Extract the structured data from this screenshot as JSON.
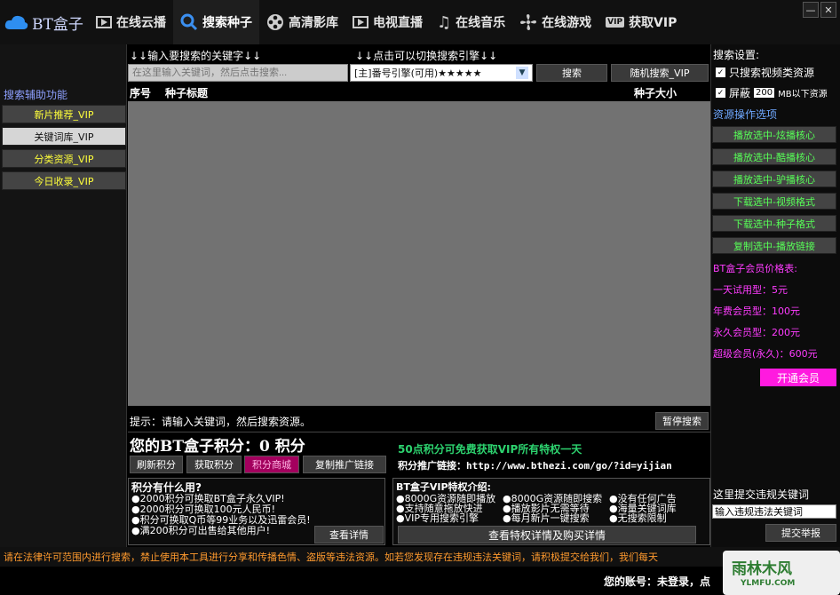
{
  "app": {
    "logo_text": "BT盒子"
  },
  "nav": [
    {
      "label": "在线云播",
      "icon": "play-icon"
    },
    {
      "label": "搜索种子",
      "icon": "search-icon",
      "active": true
    },
    {
      "label": "高清影库",
      "icon": "film-reel-icon"
    },
    {
      "label": "电视直播",
      "icon": "tv-icon"
    },
    {
      "label": "在线音乐",
      "icon": "music-icon"
    },
    {
      "label": "在线游戏",
      "icon": "fan-icon"
    },
    {
      "label": "获取VIP",
      "icon": "vip-icon"
    }
  ],
  "left": {
    "title": "搜索辅助功能",
    "items": [
      "新片推荐_VIP",
      "关键词库_VIP",
      "分类资源_VIP",
      "今日收录_VIP"
    ]
  },
  "search": {
    "hint_left": "↓↓输入要搜索的关键字↓↓",
    "hint_right": "↓↓点击可以切换搜索引擎↓↓",
    "placeholder": "在这里输入关键词，然后点击搜索...",
    "engine": "[主]番号引擎(可用)★★★★★",
    "search_btn": "搜索",
    "random_btn": "随机搜索_VIP"
  },
  "table": {
    "col_index": "序号",
    "col_title": "种子标题",
    "col_size": "种子大小"
  },
  "status": {
    "hint": "提示：请输入关键词，然后搜索资源。",
    "pause": "暂停搜索"
  },
  "points": {
    "label": "您的BT盒子积分：0 积分",
    "promo": "50点积分可免费获取VIP所有特权一天",
    "buttons": [
      "刷新积分",
      "获取积分",
      "积分商城",
      "复制推广链接"
    ],
    "link_label": "积分推广链接：http://www.bthezi.com/go/?id=yijian"
  },
  "points_box": {
    "title": "积分有什么用?",
    "lines": [
      "●2000积分可换取BT盒子永久VIP!",
      "●2000积分可换取100元人民币!",
      "●积分可换取Q币等99业务以及迅雷会员!",
      "●满200积分可出售给其他用户!"
    ],
    "btn": "查看详情"
  },
  "vip_box": {
    "title": "BT盒子VIP特权介绍:",
    "cells": [
      "●8000G资源随即播放",
      "●8000G资源随即搜索",
      "●没有任何广告",
      "●支持随意拖放快进",
      "●播放影片无需等待",
      "●海量关键词库",
      "●VIP专用搜索引擎",
      "●每月新片一键搜索",
      "●无搜索限制"
    ],
    "btn": "查看特权详情及购买详情"
  },
  "right": {
    "settings": "搜索设置:",
    "opt1": "只搜索视频类资源",
    "opt2_pre": "屏蔽",
    "opt2_val": "200",
    "opt2_post": "MB以下资源",
    "ops_title": "资源操作选项",
    "ops": [
      "播放选中-炫播核心",
      "播放选中-酷播核心",
      "播放选中-驴播核心",
      "下载选中-视频格式",
      "下载选中-种子格式",
      "复制选中-播放链接"
    ],
    "price_title": "BT盒子会员价格表:",
    "prices": [
      "一天试用型：5元",
      "年费会员型：100元",
      "永久会员型：200元",
      "超级会员(永久)：600元"
    ],
    "open_btn": "开通会员",
    "report_title": "这里提交违规关键词",
    "report_ph": "输入违规违法关键词",
    "report_btn": "提交举报"
  },
  "footer": {
    "notice": "请在法律许可范围内进行搜索，禁止使用本工具进行分享和传播色情、盗版等违法资源。如若您发现存在违规违法关键词，请积极提交给我们，我们每天",
    "account": "您的账号：未登录，点"
  },
  "watermark": {
    "text": "雨林木风",
    "url": "YLMFU.COM"
  }
}
